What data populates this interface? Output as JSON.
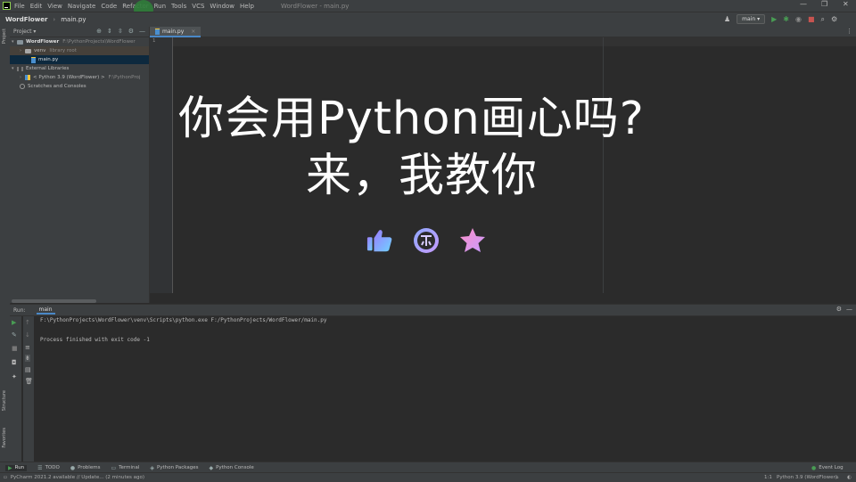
{
  "menubar": {
    "items": [
      "File",
      "Edit",
      "View",
      "Navigate",
      "Code",
      "Refactor",
      "Run",
      "Tools",
      "VCS",
      "Window",
      "Help"
    ],
    "window_title": "WordFlower - main.py",
    "minimize": "—",
    "restore": "❐",
    "close": "✕"
  },
  "navbar": {
    "project": "WordFlower",
    "file": "main.py",
    "run_config": "main ▾"
  },
  "left_stripe": {
    "project": "Project",
    "structure": "Structure",
    "favorites": "Favorites"
  },
  "project_panel": {
    "header": "Project ▾",
    "tree": [
      {
        "label": "WordFlower",
        "note": "F:\\PythonProjects\\WordFlower"
      },
      {
        "label": "venv",
        "note": "library root"
      },
      {
        "label": "main.py",
        "note": ""
      },
      {
        "label": "External Libraries",
        "note": ""
      },
      {
        "label": "< Python 3.9 (WordFlower) >",
        "note": "F:\\PythonProj"
      },
      {
        "label": "Scratches and Consoles",
        "note": ""
      }
    ]
  },
  "editor": {
    "tab": "main.py",
    "tab_close": "×",
    "line_number": "1",
    "overlay_line1": "你会用Python画心吗?",
    "overlay_line2": "来，我教你"
  },
  "run_panel": {
    "label": "Run:",
    "tab": "main",
    "console": [
      "F:\\PythonProjects\\WordFlower\\venv\\Scripts\\python.exe F:/PythonProjects/WordFlower/main.py",
      "",
      "Process finished with exit code -1"
    ]
  },
  "bottom_tabs": [
    "Run",
    "TODO",
    "Problems",
    "Terminal",
    "Python Packages",
    "Python Console"
  ],
  "event_log": "Event Log",
  "statusbar": {
    "message": "PyCharm 2021.2 available // Update... (2 minutes ago)",
    "position": "1:1",
    "interpreter": "Python 3.9 (WordFlower)"
  },
  "colors": {
    "accent": "#4a88c7",
    "run_green": "#499c54",
    "like_gradient": [
      "#9b7bff",
      "#6fd2ff"
    ],
    "coin_gradient": [
      "#8fa8ff",
      "#c59bff"
    ],
    "star_gradient": [
      "#ff8fc8",
      "#c69bff"
    ]
  }
}
